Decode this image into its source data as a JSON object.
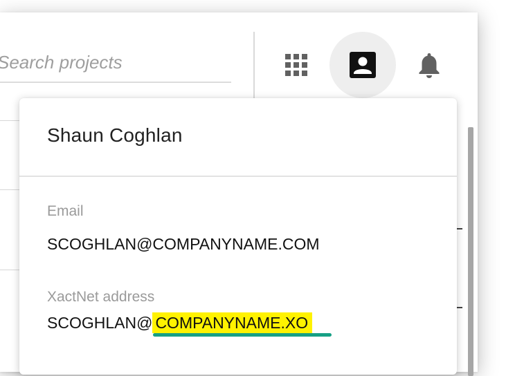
{
  "header": {
    "search_placeholder": "Search projects",
    "apps_icon": "apps-grid-icon",
    "account_icon": "account-box-icon",
    "notifications_icon": "bell-icon"
  },
  "profile": {
    "name": "Shaun Coghlan",
    "email_label": "Email",
    "email_value": "SCOGHLAN@COMPANYNAME.COM",
    "xactnet_label": "XactNet address",
    "xactnet_user": "SCOGHLAN@",
    "xactnet_domain": "COMPANYNAME.XO"
  },
  "colors": {
    "highlight": "#fff200",
    "underline": "#16a085",
    "icon": "#616161"
  }
}
